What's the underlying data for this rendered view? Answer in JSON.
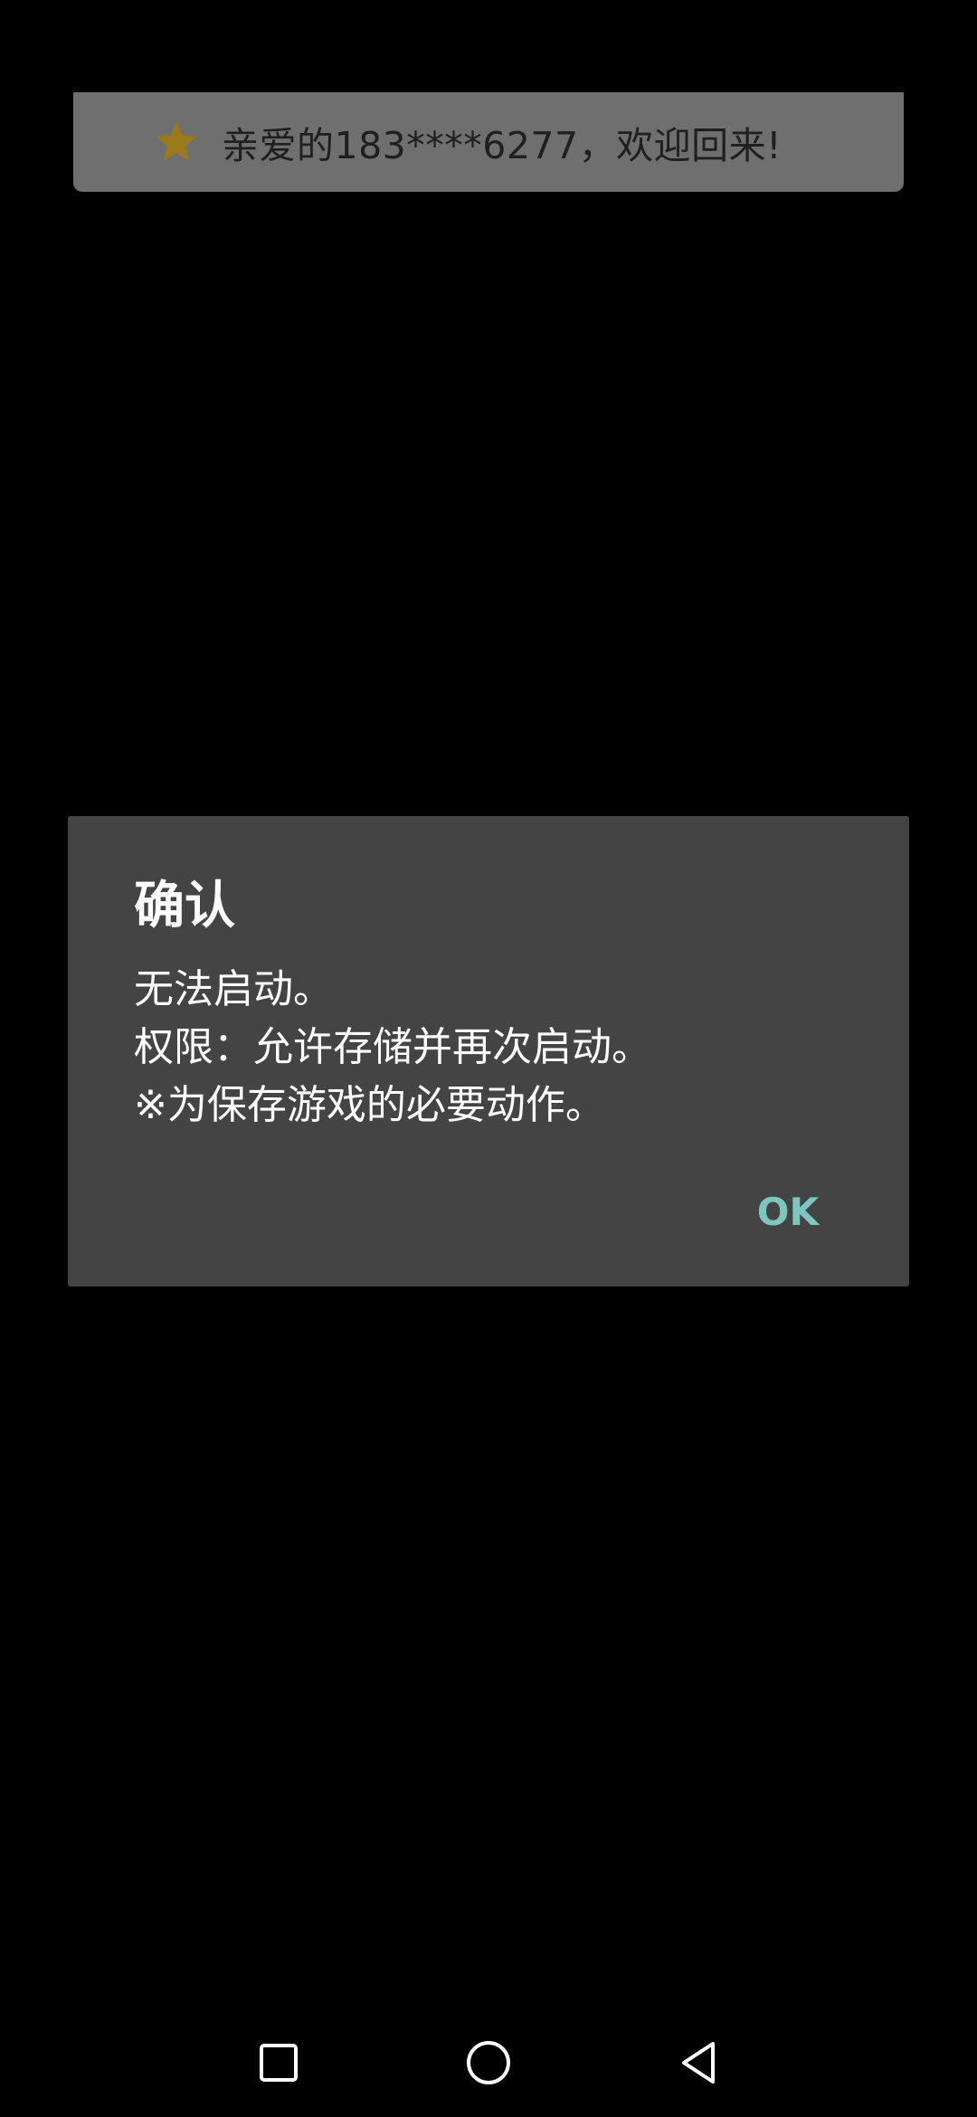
{
  "toast": {
    "icon": "star-icon",
    "star_color": "#9a7a1a",
    "message": "亲爱的183****6277，欢迎回来!"
  },
  "dialog": {
    "title": "确认",
    "lines": [
      "无法启动。",
      "权限：允许存储并再次启动。",
      "※为保存游戏的必要动作。"
    ],
    "ok_label": "OK",
    "accent_color": "#7ec7c0"
  },
  "navbar": {
    "recents_icon": "square-recents-icon",
    "home_icon": "circle-home-icon",
    "back_icon": "triangle-back-icon"
  }
}
